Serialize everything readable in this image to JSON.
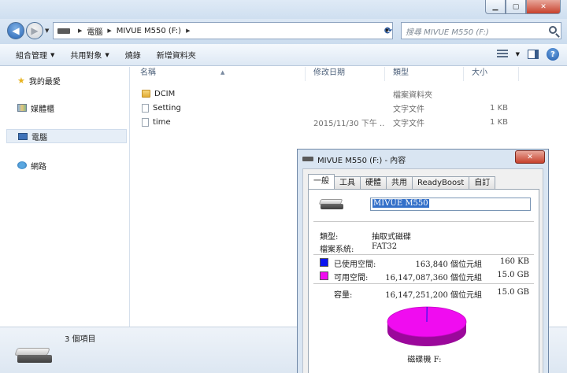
{
  "window": {
    "caption_buttons": {
      "minimize": "▁",
      "maximize": "▢",
      "close": "✕"
    }
  },
  "address_bar": {
    "breadcrumbs": [
      "電腦",
      "MIVUE M550 (F:)"
    ],
    "search_placeholder": "搜尋 MIVUE M550 (F:)"
  },
  "toolbar": {
    "organize": "組合管理",
    "share": "共用對象",
    "burn": "燒錄",
    "new_folder": "新增資料夾"
  },
  "nav_pane": {
    "favorites": "我的最愛",
    "libraries": "媒體櫃",
    "computer": "電腦",
    "network": "網路"
  },
  "columns": {
    "name": "名稱",
    "modified": "修改日期",
    "type": "類型",
    "size": "大小"
  },
  "files": [
    {
      "name": "DCIM",
      "modified": "",
      "type": "檔案資料夾",
      "size": "",
      "icon": "folder-icon"
    },
    {
      "name": "Setting",
      "modified": "",
      "type": "文字文件",
      "size": "1 KB",
      "icon": "document-icon"
    },
    {
      "name": "time",
      "modified": "2015/11/30 下午 ...",
      "type": "文字文件",
      "size": "1 KB",
      "icon": "document-icon"
    }
  ],
  "status_bar": {
    "item_count": "3 個項目"
  },
  "dialog": {
    "title": "MIVUE M550 (F:) - 內容",
    "close": "✕",
    "tabs": [
      "一般",
      "工具",
      "硬體",
      "共用",
      "ReadyBoost",
      "自訂"
    ],
    "active_tab": "一般",
    "volume_label": "MIVUE M550",
    "type_label": "類型:",
    "type_value": "抽取式磁碟",
    "fs_label": "檔案系統:",
    "fs_value": "FAT32",
    "used_label": "已使用空間:",
    "used_bytes": "163,840 個位元組",
    "used_size": "160 KB",
    "used_color": "#0a14f0",
    "free_label": "可用空間:",
    "free_bytes": "16,147,087,360 個位元組",
    "free_size": "15.0 GB",
    "free_color": "#f00cf0",
    "capacity_label": "容量:",
    "capacity_bytes": "16,147,251,200 個位元組",
    "capacity_size": "15.0 GB",
    "pie_caption": "磁碟機 F:"
  }
}
